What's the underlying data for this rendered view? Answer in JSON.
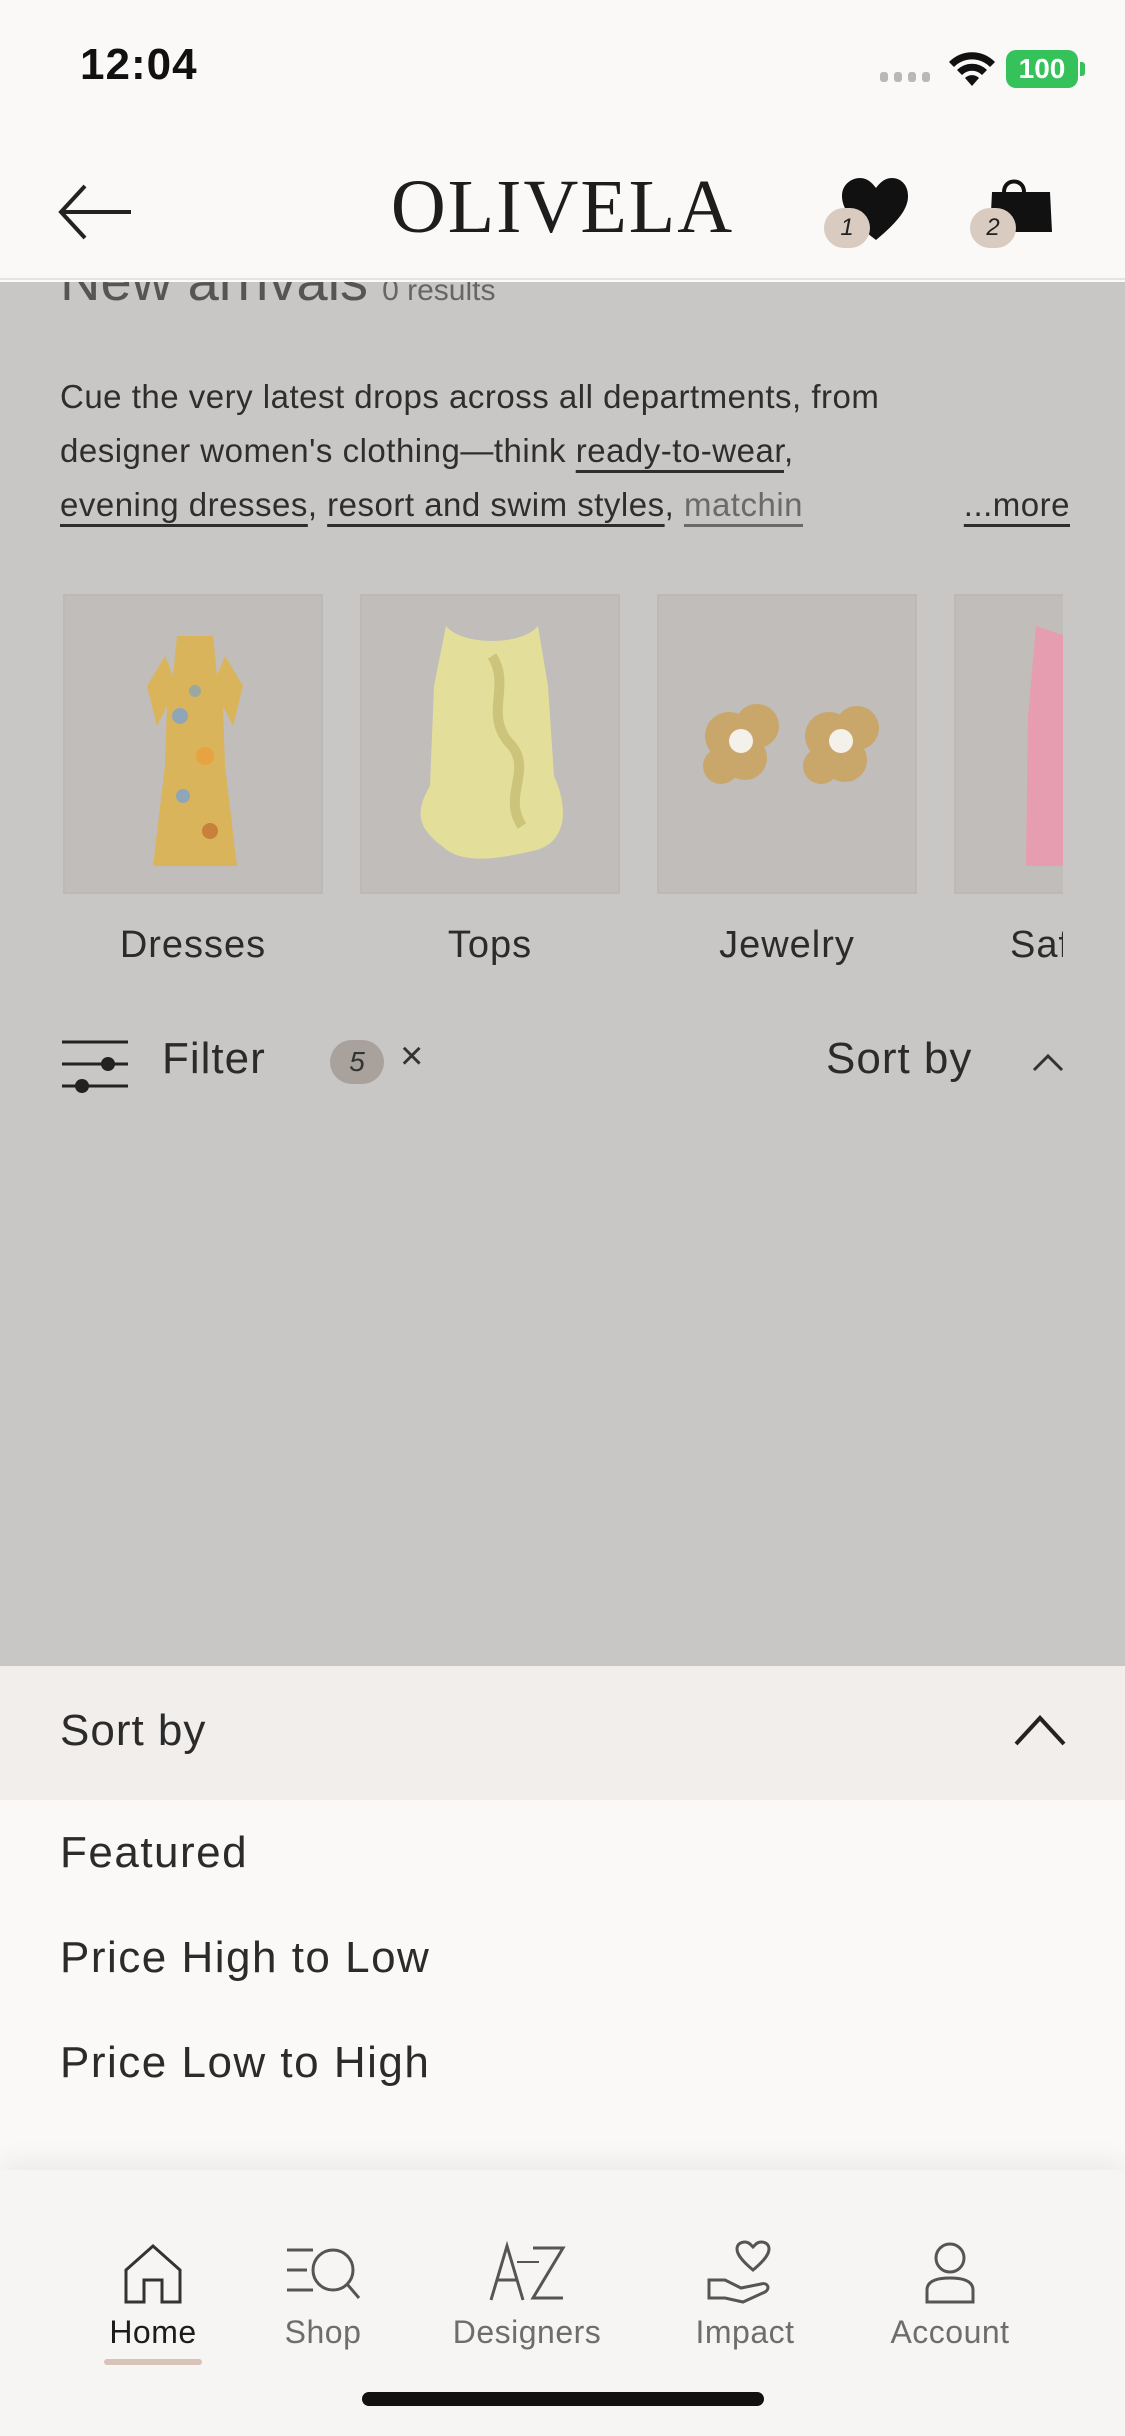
{
  "status_bar": {
    "time": "12:04",
    "battery": "100"
  },
  "header": {
    "logo": "OLIVELA",
    "wishlist_count": "1",
    "bag_count": "2"
  },
  "page": {
    "title_partial": "New arrivals",
    "results_partial": "0 results",
    "description": {
      "line1": "Cue the very latest drops across all departments, from",
      "line2_prefix": "designer women's clothing—think ",
      "link_ready": "ready-to-wear",
      "line2_suffix": ",",
      "link_evening": "evening dresses",
      "link_resort": "resort and swim styles",
      "link_matching": "matchin",
      "more": "...more"
    },
    "categories": [
      {
        "label": "Dresses",
        "icon": "dress-image"
      },
      {
        "label": "Tops",
        "icon": "top-image"
      },
      {
        "label": "Jewelry",
        "icon": "earrings-image"
      },
      {
        "label": "Saf",
        "icon": "pink-item-image"
      }
    ],
    "filter": {
      "label": "Filter",
      "count": "5",
      "clear": "×"
    },
    "sort": {
      "label": "Sort by"
    }
  },
  "sort_sheet": {
    "title": "Sort by",
    "options": [
      "Featured",
      "Price High to Low",
      "Price Low to High"
    ]
  },
  "tabbar": {
    "items": [
      {
        "label": "Home",
        "icon": "home-icon",
        "active": true
      },
      {
        "label": "Shop",
        "icon": "shop-search-icon",
        "active": false
      },
      {
        "label": "Designers",
        "icon": "a-to-z-icon",
        "active": false
      },
      {
        "label": "Impact",
        "icon": "heart-hand-icon",
        "active": false
      },
      {
        "label": "Account",
        "icon": "person-icon",
        "active": false
      }
    ]
  },
  "colors": {
    "accent": "#d7c3b8",
    "overlay": "#c9c7c5",
    "battery": "#36c25a"
  }
}
